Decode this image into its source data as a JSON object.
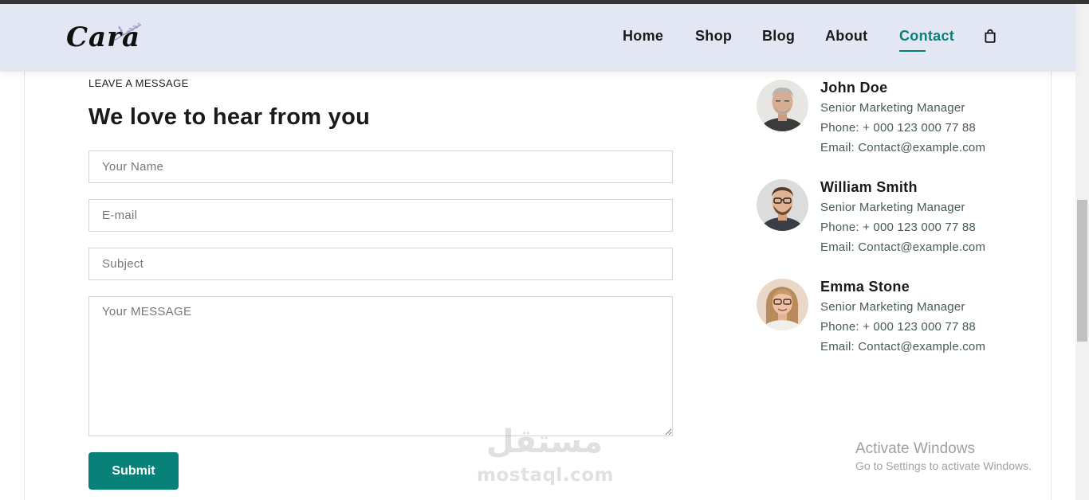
{
  "brand": {
    "logo_text": "Cara"
  },
  "nav": {
    "items": [
      {
        "label": "Home"
      },
      {
        "label": "Shop"
      },
      {
        "label": "Blog"
      },
      {
        "label": "About"
      },
      {
        "label": "Contact",
        "active": true
      }
    ],
    "cart_icon": "shopping-bag-icon",
    "accent_color": "#088178"
  },
  "contact_form": {
    "eyebrow": "LEAVE A MESSAGE",
    "heading": "We love to hear from you",
    "name_placeholder": "Your Name",
    "email_placeholder": "E-mail",
    "subject_placeholder": "Subject",
    "message_placeholder": "Your MESSAGE",
    "submit_label": "Submit"
  },
  "people": [
    {
      "name": "John Doe",
      "title": "Senior Marketing Manager",
      "phone": "Phone: + 000 123 000 77 88",
      "email": "Email: Contact@example.com"
    },
    {
      "name": "William Smith",
      "title": "Senior Marketing Manager",
      "phone": "Phone: + 000 123 000 77 88",
      "email": "Email: Contact@example.com"
    },
    {
      "name": "Emma Stone",
      "title": "Senior Marketing Manager",
      "phone": "Phone: + 000 123 000 77 88",
      "email": "Email: Contact@example.com"
    }
  ],
  "watermark": {
    "arabic": "مستقل",
    "latin": "mostaql.com"
  },
  "os_notice": {
    "title": "Activate Windows",
    "subtitle": "Go to Settings to activate Windows."
  }
}
